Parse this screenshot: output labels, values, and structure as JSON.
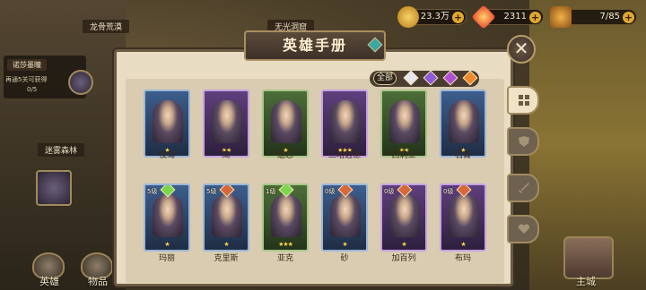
{
  "map": {
    "labels": [
      "龙骨荒漠",
      "无光洞窟",
      "迷雾森林"
    ],
    "quest": {
      "title": "诺莎墨瞳",
      "desc": "再通5关可获得",
      "progress": "0/5"
    }
  },
  "resources": [
    {
      "name": "gold",
      "icon": "gold-coin-icon",
      "value": "23.3万",
      "color": "#e7a628"
    },
    {
      "name": "diamond",
      "icon": "diamond-icon",
      "value": "2311",
      "color": "#e8402c"
    },
    {
      "name": "stamina",
      "icon": "treasure-chest-icon",
      "value": "7/85",
      "color": "#d9872a"
    }
  ],
  "dialog": {
    "title": "英雄手册",
    "close_icon": "close-x-icon",
    "filter": {
      "all_label": "全部",
      "gems": [
        {
          "name": "white-gem-icon",
          "color": "#e6e6f0"
        },
        {
          "name": "purple-gem-icon",
          "color": "#8e5ad6"
        },
        {
          "name": "violet-gem-icon",
          "color": "#b24ed4"
        },
        {
          "name": "orange-gem-icon",
          "color": "#ee8a2a"
        }
      ]
    },
    "side_tabs": [
      {
        "name": "tab-all",
        "icon": "grid-icon",
        "active": true
      },
      {
        "name": "tab-shield",
        "icon": "shield-icon",
        "active": false
      },
      {
        "name": "tab-sword",
        "icon": "sword-icon",
        "active": false
      },
      {
        "name": "tab-heart",
        "icon": "heart-icon",
        "active": false
      }
    ],
    "heroes_row1": [
      {
        "name": "夜莺",
        "stars": "★",
        "rarity": "blue",
        "level": ""
      },
      {
        "name": "简",
        "stars": "★★",
        "rarity": "purple",
        "level": ""
      },
      {
        "name": "遗忘",
        "stars": "★",
        "rarity": "green",
        "level": ""
      },
      {
        "name": "二哈迈德",
        "stars": "★★★",
        "rarity": "purple",
        "level": ""
      },
      {
        "name": "西莉亚",
        "stars": "★★",
        "rarity": "green",
        "level": ""
      },
      {
        "name": "石臂",
        "stars": "★",
        "rarity": "blue",
        "level": ""
      }
    ],
    "heroes_row2": [
      {
        "name": "玛丽",
        "stars": "★",
        "rarity": "blue",
        "level": "5级",
        "badge": "#7bd64a"
      },
      {
        "name": "克里斯",
        "stars": "★",
        "rarity": "blue",
        "level": "5级",
        "badge": "#d6683a"
      },
      {
        "name": "亚克",
        "stars": "★★★",
        "rarity": "green",
        "level": "1级",
        "badge": "#7bd64a"
      },
      {
        "name": "砂",
        "stars": "★",
        "rarity": "blue",
        "level": "0级",
        "badge": "#d6683a"
      },
      {
        "name": "加百列",
        "stars": "★",
        "rarity": "purple",
        "level": "0级",
        "badge": "#d6683a"
      },
      {
        "name": "布玛",
        "stars": "★",
        "rarity": "purple",
        "level": "0级",
        "badge": "#d6683a"
      }
    ]
  },
  "bottom_nav": [
    {
      "label": "英雄",
      "icon": "helmet-icon"
    },
    {
      "label": "物品",
      "icon": "bag-icon"
    },
    {
      "label": "主城",
      "icon": "castle-icon"
    }
  ]
}
